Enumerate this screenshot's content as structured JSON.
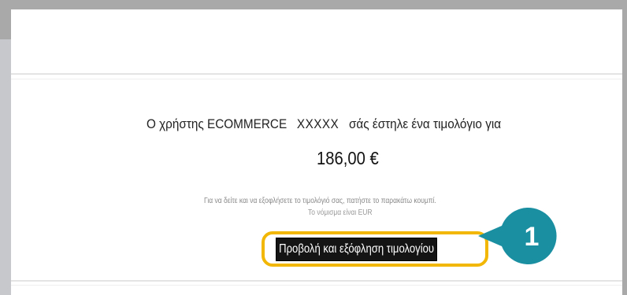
{
  "email": {
    "message_prefix": "Ο χρήστης ECOMMERCE",
    "masked_sender": "XXXXX",
    "message_suffix": "σάς έστηλε ένα τιμολόγιο για",
    "amount": "186,00 €",
    "instructions": "Για να δείτε και να εξοφλήσετε το τιμολόγιό σας, πατήστε το παρακάτω κουμπί.",
    "currency_note": "Το νόμισμα είναι EUR",
    "invoice_button_label": "Προβολή και εξόφληση τιμολογίου"
  },
  "annotation": {
    "callout_number": "1",
    "highlight_color": "#f2b705",
    "callout_color": "#1b8fa2"
  }
}
